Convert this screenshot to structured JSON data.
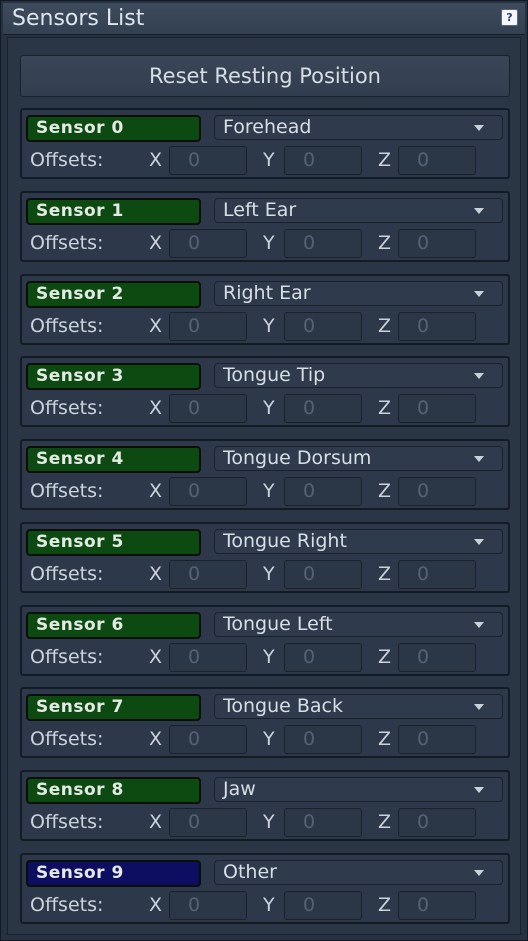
{
  "window": {
    "title": "Sensors List",
    "help_label": "?"
  },
  "reset_button": "Reset Resting Position",
  "labels": {
    "offsets": "Offsets:",
    "x": "X",
    "y": "Y",
    "z": "Z"
  },
  "sensors": [
    {
      "name": "Sensor 0",
      "location": "Forehead",
      "x": "0",
      "y": "0",
      "z": "0",
      "tag_color": "#0c4a12"
    },
    {
      "name": "Sensor 1",
      "location": "Left Ear",
      "x": "0",
      "y": "0",
      "z": "0",
      "tag_color": "#0c4a12"
    },
    {
      "name": "Sensor 2",
      "location": "Right Ear",
      "x": "0",
      "y": "0",
      "z": "0",
      "tag_color": "#0c4a12"
    },
    {
      "name": "Sensor 3",
      "location": "Tongue Tip",
      "x": "0",
      "y": "0",
      "z": "0",
      "tag_color": "#0c4a12"
    },
    {
      "name": "Sensor 4",
      "location": "Tongue Dorsum",
      "x": "0",
      "y": "0",
      "z": "0",
      "tag_color": "#0c4a12"
    },
    {
      "name": "Sensor 5",
      "location": "Tongue Right",
      "x": "0",
      "y": "0",
      "z": "0",
      "tag_color": "#0c4a12"
    },
    {
      "name": "Sensor 6",
      "location": "Tongue Left",
      "x": "0",
      "y": "0",
      "z": "0",
      "tag_color": "#0c4a12"
    },
    {
      "name": "Sensor 7",
      "location": "Tongue Back",
      "x": "0",
      "y": "0",
      "z": "0",
      "tag_color": "#0c4a12"
    },
    {
      "name": "Sensor 8",
      "location": "Jaw",
      "x": "0",
      "y": "0",
      "z": "0",
      "tag_color": "#0c4a12"
    },
    {
      "name": "Sensor 9",
      "location": "Other",
      "x": "0",
      "y": "0",
      "z": "0",
      "tag_color": "#0d0d62"
    }
  ]
}
